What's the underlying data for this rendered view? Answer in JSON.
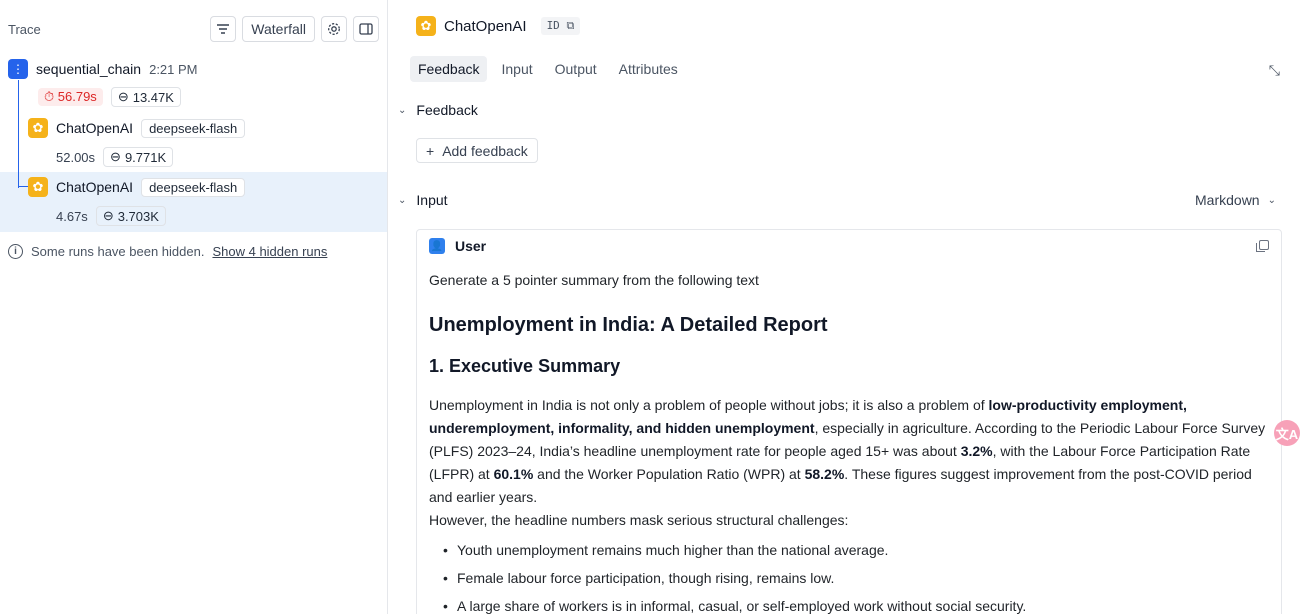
{
  "trace": {
    "title": "Trace",
    "waterfall_label": "Waterfall",
    "runs": [
      {
        "name": "sequential_chain",
        "time": "2:21 PM",
        "latency": "56.79s",
        "tokens": "13.47K"
      },
      {
        "name": "ChatOpenAI",
        "tag": "deepseek-flash",
        "latency": "52.00s",
        "tokens": "9.771K"
      },
      {
        "name": "ChatOpenAI",
        "tag": "deepseek-flash",
        "latency": "4.67s",
        "tokens": "3.703K"
      }
    ],
    "hidden_note": "Some runs have been hidden.",
    "hidden_link": "Show 4 hidden runs"
  },
  "detail": {
    "title": "ChatOpenAI",
    "id_badge": "ID",
    "tabs": [
      "Feedback",
      "Input",
      "Output",
      "Attributes"
    ],
    "feedback_section": "Feedback",
    "add_feedback": "Add feedback",
    "input_section": "Input",
    "format_select": "Markdown",
    "message": {
      "role": "User",
      "prompt": "Generate a 5 pointer summary from the following text",
      "h1": "Unemployment in India: A Detailed Report",
      "h2": "1. Executive Summary",
      "p1_a": "Unemployment in India is not only a problem of people without jobs; it is also a problem of ",
      "p1_b": "low-productivity employment, underemployment, informality, and hidden unemployment",
      "p1_c": ", especially in agriculture. According to the Periodic Labour Force Survey (PLFS) 2023–24, India’s headline unemployment rate for people aged 15+ was about ",
      "p1_d": "3.2%",
      "p1_e": ", with the Labour Force Participation Rate (LFPR) at ",
      "p1_f": "60.1%",
      "p1_g": " and the Worker Population Ratio (WPR) at ",
      "p1_h": "58.2%",
      "p1_i": ". These figures suggest improvement from the post-COVID period and earlier years.",
      "p2": "However, the headline numbers mask serious structural challenges:",
      "bullets": [
        "Youth unemployment remains much higher than the national average.",
        "Female labour force participation, though rising, remains low.",
        "A large share of workers is in informal, casual, or self-employed work without social security."
      ]
    }
  },
  "colors": {
    "accent": "#2563eb",
    "selected": "#e8f1fb",
    "latency_red": "#dc2626",
    "openai_icon": "#f5b21a"
  }
}
